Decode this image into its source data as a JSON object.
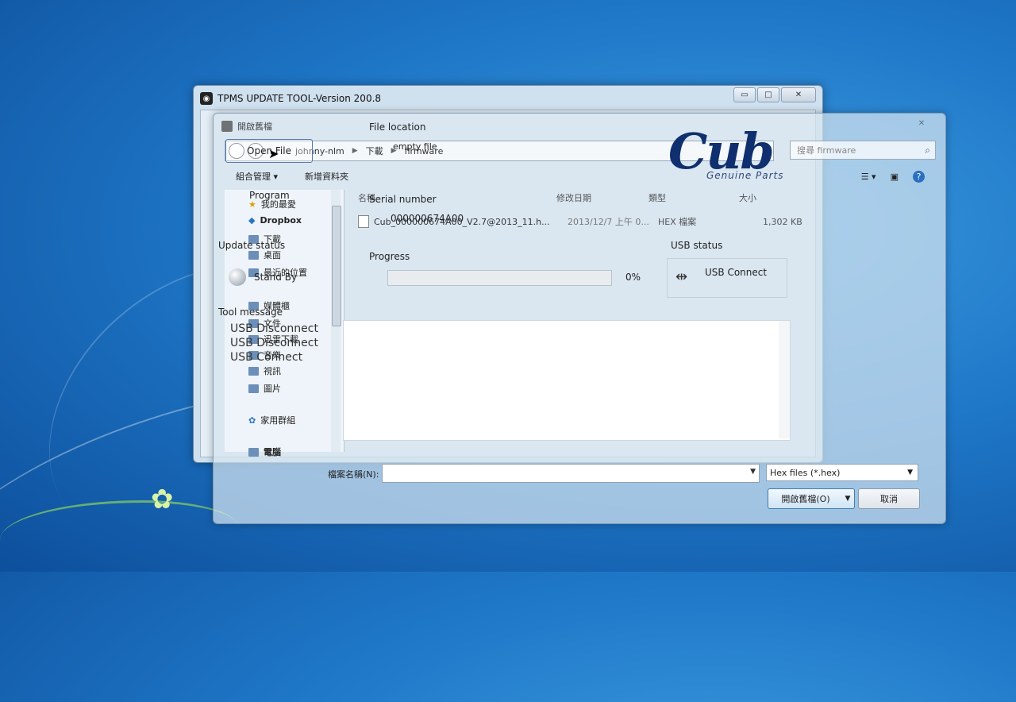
{
  "tool_window": {
    "title": "TPMS UPDATE TOOL-Version 200.8",
    "minimize": "▭",
    "maximize": "□",
    "close": "✕"
  },
  "tool": {
    "open_file_label": "Open File",
    "file_location_label": "File location",
    "file_location_value": "empty file",
    "program_label": "Program",
    "serial_number_label": "Serial number",
    "serial_number_value": "000000674A00",
    "update_status_label": "Update status",
    "update_status_value": "Stand By",
    "progress_label": "Progress",
    "progress_percent_text": "0%",
    "progress_value": 0,
    "usb_status_label": "USB status",
    "usb_status_value": "USB Connect",
    "tool_message_label": "Tool message",
    "messages": [
      "USB Disconnect",
      "USB Disconnect",
      "USB Connect"
    ]
  },
  "logo": {
    "main": "Cub",
    "sub": "Genuine Parts",
    "color": "#0f2f6e"
  },
  "open_dialog": {
    "title": "開啟舊檔",
    "close": "✕",
    "breadcrumbs": [
      "johnny-nlm",
      "下載",
      "firmware"
    ],
    "search_placeholder": "搜尋 firmware",
    "toolbar": {
      "organize": "組合管理 ▾",
      "new_folder": "新增資料夾"
    },
    "nav_items": [
      "我的最愛",
      "Dropbox",
      "下載",
      "桌面",
      "最近的位置",
      "媒體櫃",
      "文件",
      "迅雷下載",
      "音樂",
      "視訊",
      "圖片",
      "家用群組",
      "電腦"
    ],
    "columns": [
      "名稱",
      "修改日期",
      "類型",
      "大小"
    ],
    "files": [
      {
        "name": "Cub_000000674A00_V2.7@2013_11.h...",
        "modified": "2013/12/7 上午 0...",
        "type": "HEX 檔案",
        "size": "1,302 KB"
      }
    ],
    "filename_label": "檔案名稱(N):",
    "filename_value": "",
    "file_type_value": "Hex files (*.hex)",
    "open_button": "開啟舊檔(O)",
    "cancel_button": "取消"
  },
  "colors": {
    "desktop": "#1f78c8",
    "progress_fill": "#4caf50",
    "accent_border": "#3c7fb1"
  }
}
